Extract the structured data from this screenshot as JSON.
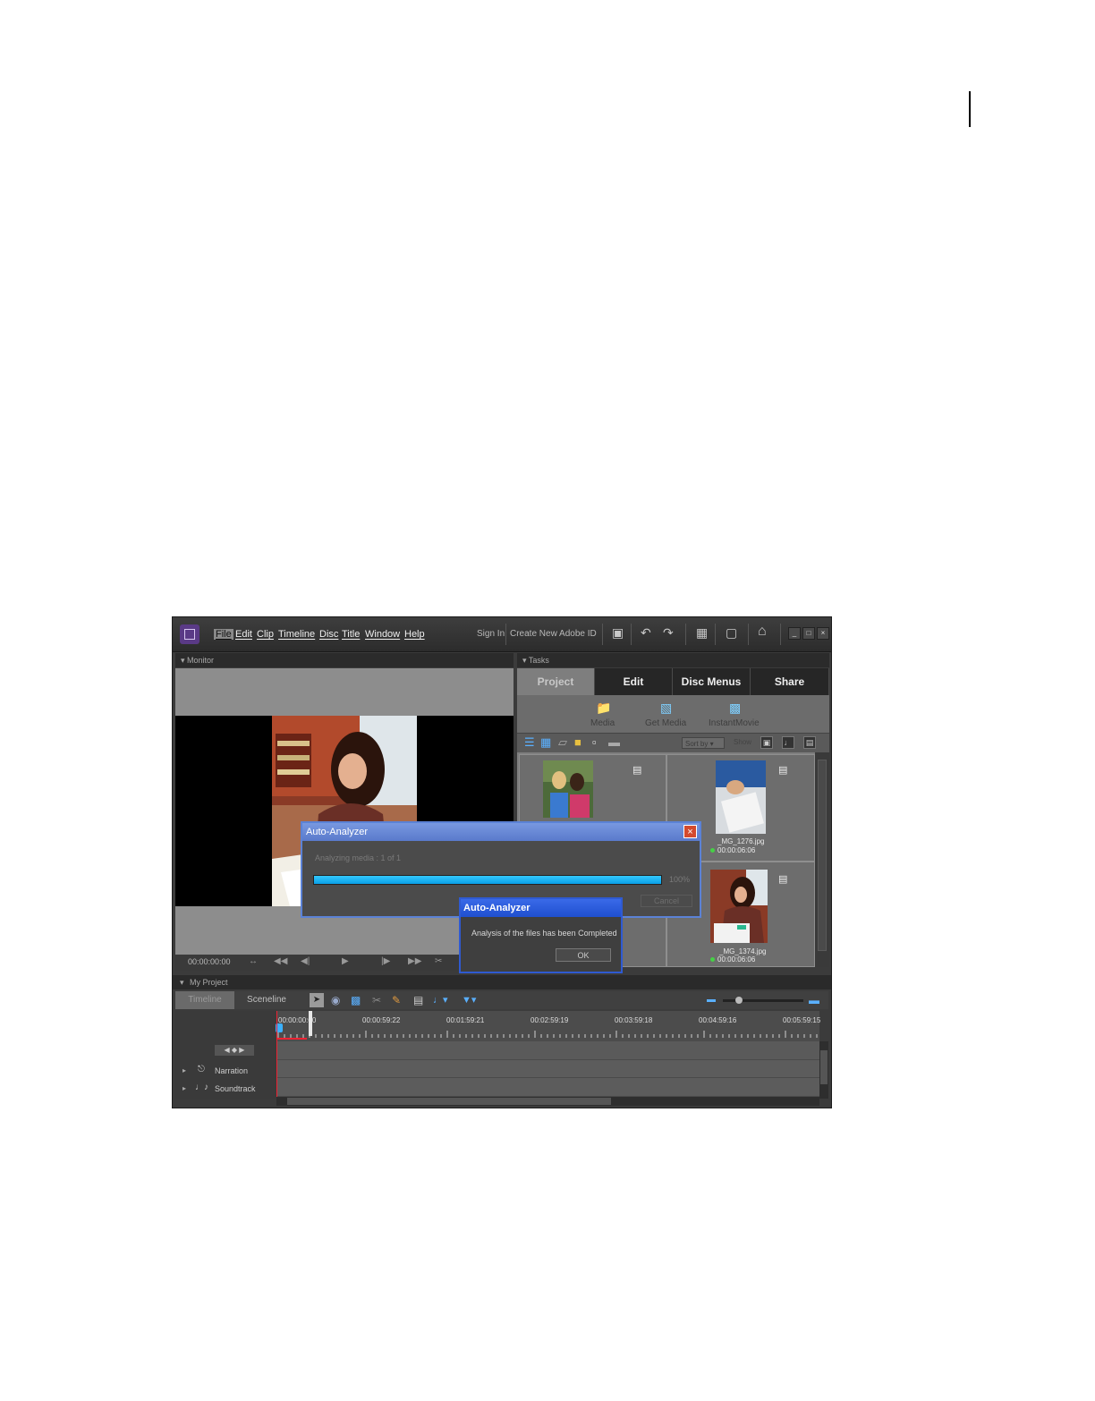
{
  "menu": {
    "file": "File",
    "edit": "Edit",
    "clip": "Clip",
    "timeline": "Timeline",
    "disc": "Disc",
    "title": "Title",
    "window": "Window",
    "help": "Help"
  },
  "account": {
    "sign_in": "Sign In",
    "create_id": "Create New Adobe ID"
  },
  "panels": {
    "monitor": "Monitor",
    "tasks": "Tasks",
    "project": "My Project"
  },
  "tabs": [
    "Project",
    "Edit",
    "Disc Menus",
    "Share"
  ],
  "task_buttons": [
    "Media",
    "Get Media",
    "InstantMovie"
  ],
  "toolbar": {
    "sort_by": "Sort by",
    "show": "Show"
  },
  "media_items": [
    {
      "name": "_MG_1276.jpg",
      "duration": "00:00:06:06"
    },
    {
      "name": "_MG_1374.jpg",
      "duration": "00:00:06:06"
    }
  ],
  "monitor": {
    "timecode": "00:00:00:00"
  },
  "analyzer": {
    "title": "Auto-Analyzer",
    "status": "Analyzing media : 1 of 1",
    "percent": "100%",
    "progress": 1.0,
    "cancel": "Cancel"
  },
  "completed_dialog": {
    "title": "Auto-Analyzer",
    "message": "Analysis of the files has been Completed",
    "ok": "OK"
  },
  "timeline": {
    "view_tabs": [
      "Timeline",
      "Sceneline"
    ],
    "ruler": [
      "00:00:00:00",
      "00:00:59:22",
      "00:01:59:21",
      "00:02:59:19",
      "00:03:59:18",
      "00:04:59:16",
      "00:05:59:15"
    ],
    "tracks": [
      "Narration",
      "Soundtrack"
    ]
  },
  "colors": {
    "progress": "#0aa0e6",
    "dialog_border": "#2f5ad1",
    "playhead": "#e22233"
  }
}
